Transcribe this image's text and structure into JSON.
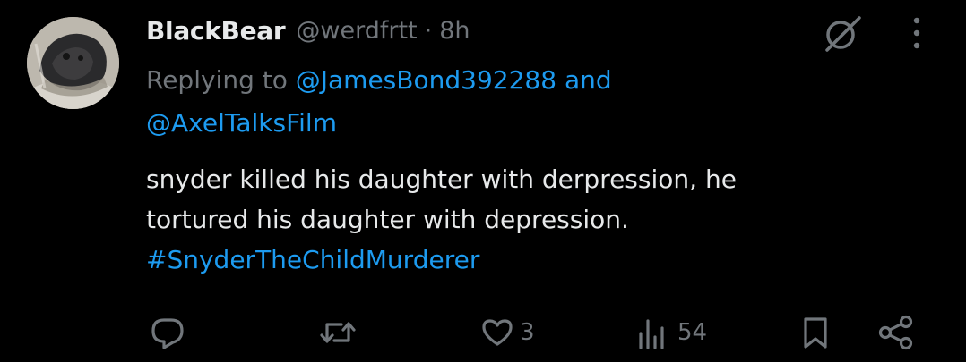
{
  "author": {
    "display_name": "BlackBear",
    "handle": "@werdfrtt",
    "separator": "·",
    "time": "8h"
  },
  "reply": {
    "prefix": "Replying to",
    "mention_1": "@JamesBond392288",
    "conjunction": "and",
    "mention_2": "@AxelTalksFilm"
  },
  "body": {
    "line_1": "snyder killed his daughter with derpression, he",
    "line_2": "tortured his daughter with depression.",
    "hashtag": "#SnyderTheChildMurderer"
  },
  "actions": {
    "reply_count": "",
    "repost_count": "",
    "like_count": "3",
    "views_count": "54"
  },
  "icons": {
    "avatar": "avatar",
    "grok": "grok-icon",
    "more": "more-dots-icon",
    "reply": "reply-icon",
    "repost": "repost-icon",
    "like": "heart-icon",
    "views": "views-icon",
    "bookmark": "bookmark-icon",
    "share": "share-icon"
  },
  "colors": {
    "background": "#000000",
    "text": "#e7e9ea",
    "muted": "#71767b",
    "accent": "#1d9bf0"
  }
}
